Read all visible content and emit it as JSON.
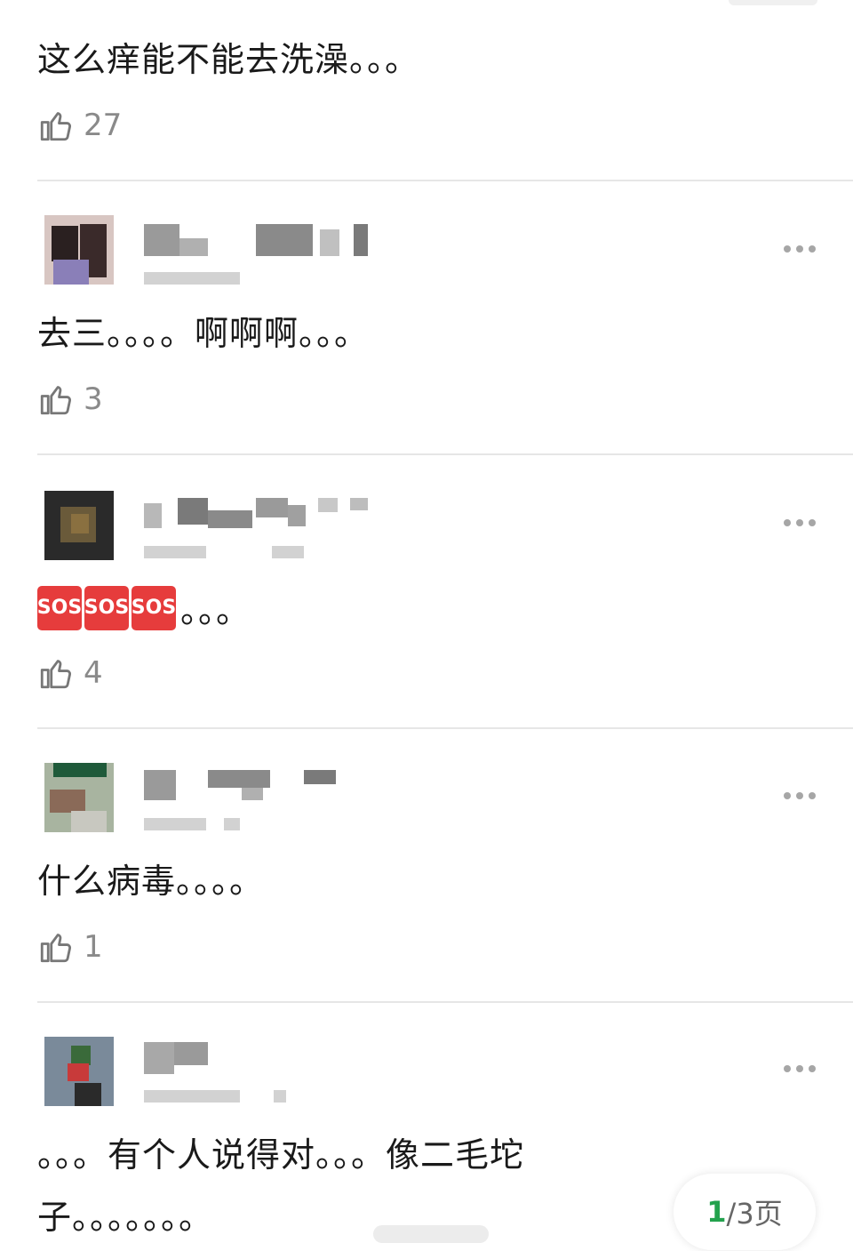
{
  "comments": [
    {
      "text": "这么痒能不能去洗澡。。。",
      "likes": "27"
    },
    {
      "text": "去三。。。。啊啊啊。。。",
      "likes": "3"
    },
    {
      "sos": [
        "SOS",
        "SOS",
        "SOS"
      ],
      "text": "。。。",
      "likes": "4"
    },
    {
      "text": "什么病毒。。。。",
      "likes": "1"
    },
    {
      "text_line1": "。。。有个人说得对。。。像二毛坨",
      "text_line2": "子。。。。。。。"
    }
  ],
  "pagination": {
    "current": "1",
    "rest": "/3页"
  },
  "colors": {
    "accent_green": "#23a24d",
    "sos_red": "#e63c3c"
  },
  "icons": [
    "thumbs-up-icon",
    "more-dots-icon",
    "avatar"
  ]
}
